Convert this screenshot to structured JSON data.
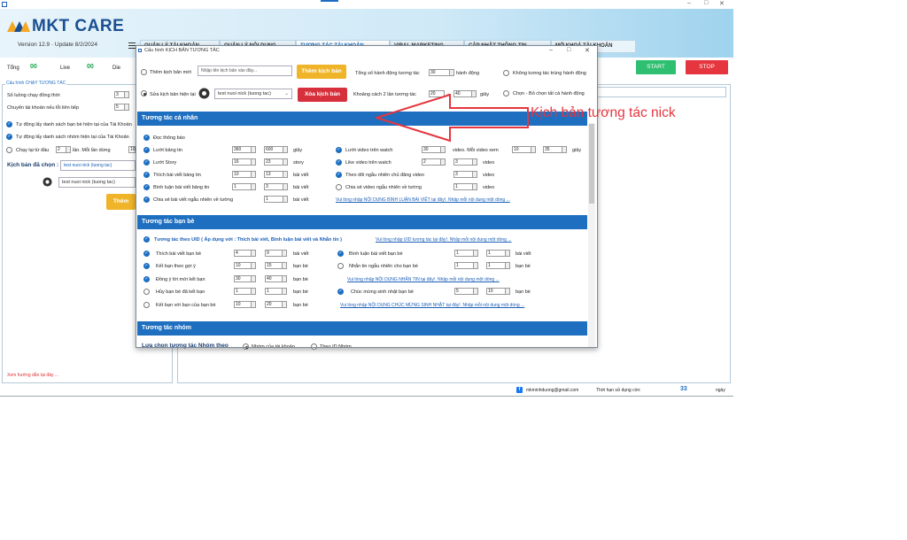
{
  "app": {
    "name": "MKT CARE",
    "version": "Version 12.9 · Update 8/2/2024"
  },
  "tabs": [
    {
      "label": "QUẢN LÝ TÀI KHOẢN"
    },
    {
      "label": "QUẢN LÝ NỘI DUNG"
    },
    {
      "label": "TƯƠNG TÁC TÀI KHOẢN"
    },
    {
      "label": "VIRAL MARKETING"
    },
    {
      "label": "CẬP NHẬT THÔNG TIN"
    },
    {
      "label": "MỞ KHOÁ TÀI KHOẢN"
    }
  ],
  "stats": {
    "total_label": "Tổng",
    "total_value": "00",
    "live_label": "Live",
    "live_value": "00",
    "die_label": "Die"
  },
  "buttons": {
    "start": "START",
    "stop": "STOP"
  },
  "left_panel": {
    "group_title": "Cấu hình CHẠY TƯƠNG TÁC",
    "threads_label": "Số luồng chạy đồng thời",
    "threads_value": "3",
    "switch_label": "Chuyển tài khoản nếu lỗi liên tiếp",
    "switch_value": "5",
    "auto_friends_label": "Tự động lấy danh sách bạn bè hiện tại của Tài Khoản",
    "auto_groups_label": "Tự động lấy danh sách nhóm hiện tại của Tài Khoản",
    "rerun_label": "Chạy lại từ đầu",
    "rerun_value": "2",
    "rerun_suffix": "lần. Mỗi lần dừng",
    "rerun_value2": "10",
    "selected_label": "Kịch bản đã chọn :",
    "selected_value": "test nuoi nick (tuong tac)",
    "combo_value": "test nuoi nick (tuong tac)",
    "add_button": "Thêm",
    "guide": "Xem hướng dẫn tại đây ..."
  },
  "footer": {
    "email": "mkminhduong@gmail.com",
    "usage_label": "Thời hạn sử dụng còn:",
    "usage_value": "33",
    "usage_unit": "ngày"
  },
  "annotation": "Kịch bản tương tác nick",
  "dialog": {
    "title": "Cấu hình KỊCH BẢN TƯƠNG TÁC",
    "new_label": "Thêm kịch bản mới",
    "new_placeholder": "Nhập tên kịch bản vào đây...",
    "add_button": "Thêm kịch bản",
    "edit_label": "Sửa kịch bản hiện tại",
    "edit_value": "test nuoi nick (tuong tac)",
    "delete_button": "Xóa kịch bản",
    "total_actions_label": "Tổng số hành động tương tác",
    "total_actions_value": "30",
    "total_actions_unit": "hành động",
    "gap_label": "Khoảng cách 2 lần tương tác",
    "gap_min": "20",
    "gap_sep": "→",
    "gap_max": "40",
    "gap_unit": "giây",
    "no_dup_label": "Không tương tác trùng hành động",
    "select_all_label": "Chọn - Bỏ chọn tất cả hành động",
    "personal": {
      "title": "Tương tác cá nhân",
      "read_notif": "Đọc thông báo",
      "rows_left": [
        {
          "label": "Lướt bảng tin",
          "a": "360",
          "b": "600",
          "unit": "giây"
        },
        {
          "label": "Lướt Story",
          "a": "16",
          "b": "23",
          "unit": "story"
        },
        {
          "label": "Thích bài viết bảng tin",
          "a": "10",
          "b": "13",
          "unit": "bài viết"
        },
        {
          "label": "Bình luận bài viết bảng tin",
          "a": "1",
          "b": "3",
          "unit": "bài viết"
        },
        {
          "label": "Chia sẻ bài viết ngẫu nhiên về tường",
          "a": "",
          "b": "1",
          "unit": "bài viết"
        }
      ],
      "watch_label": "Lướt video trên watch",
      "watch_a": "30",
      "watch_mid": "video. Mỗi video xem",
      "watch_b": "10",
      "watch_c": "35",
      "watch_unit": "giây",
      "rows_right": [
        {
          "label": "Like video trên watch",
          "a": "2",
          "b": "3",
          "unit": "video"
        },
        {
          "label": "Theo dõi ngẫu nhiên chủ đăng video",
          "a": "",
          "b": "3",
          "unit": "video"
        },
        {
          "label": "Chia sẻ video ngẫu nhiên về tường",
          "a": "",
          "b": "1",
          "unit": "video"
        }
      ],
      "link": "Vui lòng nhập NỘI DUNG BÌNH LUẬN BÀI VIẾT tại đây!. Nhập mỗi nội dung một dòng ..."
    },
    "friends": {
      "title": "Tương tác bạn bè",
      "uid_label": "Tương tác theo UID ( Áp dụng với : Thích bài viết, Bình luận bài viết và Nhắn tin )",
      "uid_link": "Vui lòng nhập UID tương tác tại đây!. Nhập mỗi nội dung một dòng ...",
      "rows_left": [
        {
          "label": "Thích bài viết bạn bè",
          "a": "4",
          "b": "9",
          "unit": "bài viết"
        },
        {
          "label": "Kết bạn theo gợi ý",
          "a": "10",
          "b": "15",
          "unit": "bạn bè"
        },
        {
          "label": "Đồng ý lời mời kết bạn",
          "a": "30",
          "b": "40",
          "unit": "bạn bè"
        },
        {
          "label": "Hủy bạn bè đã kết bạn",
          "a": "1",
          "b": "1",
          "unit": "bạn bè"
        },
        {
          "label": "Kết bạn với bạn của bạn bè",
          "a": "10",
          "b": "20",
          "unit": "bạn bè"
        }
      ],
      "rows_right": [
        {
          "label": "Bình luận bài viết bạn bè",
          "a": "1",
          "b": "1",
          "unit": "bài viết"
        },
        {
          "label": "Nhắn tin ngẫu nhiên cho bạn bè",
          "a": "1",
          "b": "1",
          "unit": "bạn bè"
        }
      ],
      "msg_link": "Vui lòng nhập NỘI DUNG NHẮN TIN tại đây!. Nhập mỗi nội dung một dòng ...",
      "bday_label": "Chúc mừng sinh nhật bạn bè",
      "bday_a": "5",
      "bday_b": "10",
      "bday_unit": "bạn bè",
      "bday_link": "Vui lòng nhập NỘI DUNG CHÚC MỪNG SINH NHẬT tại đây!. Nhập mỗi nội dung một dòng ..."
    },
    "groups": {
      "title": "Tương tác nhóm",
      "choose_label": "Lựa chọn tương tác Nhóm theo",
      "opt1": "Nhóm của tài khoản",
      "opt2": "Theo ID Nhóm"
    }
  },
  "colors": {
    "primary": "#1e6fc0",
    "start": "#2fbf71",
    "stop": "#e5353e",
    "annotation": "#e5353e",
    "accent_yellow": "#f0b429"
  }
}
